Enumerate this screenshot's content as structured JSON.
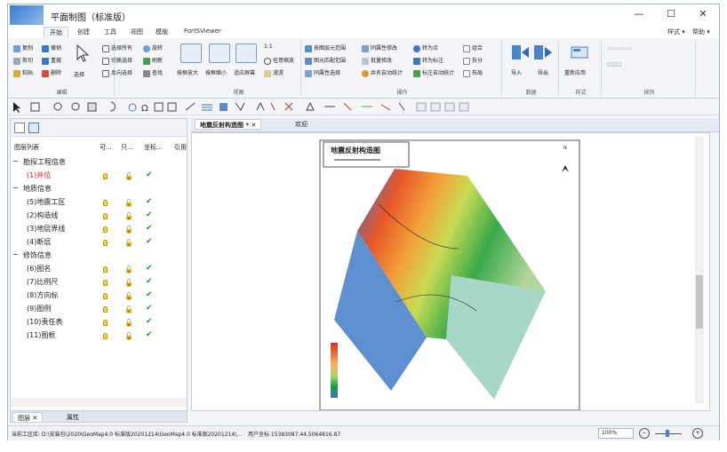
{
  "window": {
    "title": "平面制图（标准版）",
    "controls": [
      "—",
      "☐",
      "✕"
    ]
  },
  "ribbon_tabs": [
    "开始",
    "创建",
    "工具",
    "视图",
    "模版",
    "FortSViewer"
  ],
  "ribbon_right": {
    "style": "样式 ▾",
    "help": "帮助 ▾"
  },
  "ribbon": {
    "clipboard": {
      "copy": "复制",
      "cut": "剪切",
      "paste": "粘贴",
      "undo": "撤销",
      "redo": "重做",
      "delete": "删除",
      "select": "选择",
      "label": "编辑"
    },
    "select_group": {
      "select_all": "选择所有",
      "rotate": "旋转",
      "toggle_select": "切换选择",
      "refresh": "刷新",
      "reverse_select": "反向选择",
      "find": "查找"
    },
    "view_group": {
      "zoom_in": "按框放大",
      "zoom_out": "按框缩小",
      "fit_view": "适应屏幕",
      "one_to_one": "1:1",
      "free_zoom": "任意缩放",
      "pan": "漫游",
      "label": "视图"
    },
    "ops_group": {
      "by_layer_range": "按图层元范围",
      "same_attr_edit": "同属性修改",
      "convert_point": "转为点",
      "combine": "组合",
      "layer_range_select": "图元匹配范围",
      "batch_edit": "批量修改",
      "convert_label": "转为标注",
      "split": "拆分",
      "same_attr_select": "同属性选择",
      "well_auto": "井名自动统计",
      "label_auto": "标注自动统计",
      "layout": "布局",
      "label": "操作"
    },
    "data_group": {
      "import": "导入",
      "export": "导出",
      "label": "数据"
    },
    "style_group": {
      "reapply": "重新应用",
      "label": "样式"
    },
    "arrange_group": {
      "label": "排列"
    }
  },
  "left_panel": {
    "header": {
      "name": "图层列表",
      "visible": "可...",
      "readonly": "只...",
      "coord": "坐标...",
      "ref": "引用"
    },
    "rows": [
      {
        "label": "勘探工程信息",
        "type": "group",
        "sign": "−"
      },
      {
        "label": "(1)井位",
        "type": "item-red",
        "bulb": true,
        "lock": true,
        "check": true
      },
      {
        "label": "地质信息",
        "type": "group",
        "sign": "−"
      },
      {
        "label": "(5)地震工区",
        "type": "item",
        "bulb": true,
        "lock": true,
        "check": true
      },
      {
        "label": "(2)构造线",
        "type": "item",
        "bulb": true,
        "lock": true,
        "check": true
      },
      {
        "label": "(3)地层界线",
        "type": "item",
        "bulb": true,
        "lock": true,
        "check": true
      },
      {
        "label": "(4)断层",
        "type": "item",
        "bulb": true,
        "lock": true,
        "check": true
      },
      {
        "label": "修饰信息",
        "type": "group",
        "sign": "−"
      },
      {
        "label": "(6)图名",
        "type": "item",
        "bulb": true,
        "lock": true,
        "check": true
      },
      {
        "label": "(7)比例尺",
        "type": "item",
        "bulb": true,
        "lock": true,
        "check": true
      },
      {
        "label": "(8)方向标",
        "type": "item",
        "bulb": true,
        "lock": true,
        "check": true
      },
      {
        "label": "(9)图例",
        "type": "item",
        "bulb": true,
        "lock": true,
        "check": true
      },
      {
        "label": "(10)责任表",
        "type": "item",
        "bulb": true,
        "lock": true,
        "check": true
      },
      {
        "label": "(11)图框",
        "type": "item",
        "bulb": true,
        "lock": true,
        "check": true
      }
    ],
    "bottom_tabs": [
      "图层",
      "属性"
    ]
  },
  "doc_tabs": {
    "active": "地震反射构造图 *",
    "other": "欢迎"
  },
  "map": {
    "title": "地震反射构造图",
    "north": "N"
  },
  "status": {
    "path": "当前工区库: D:\\安装包\\2020\\GeoMap4.0 标准版20201214\\GeoMap4.0 标准版20201214\\...",
    "coords": "用户坐标  15383087.44,5064816.87",
    "zoom": "100%"
  }
}
